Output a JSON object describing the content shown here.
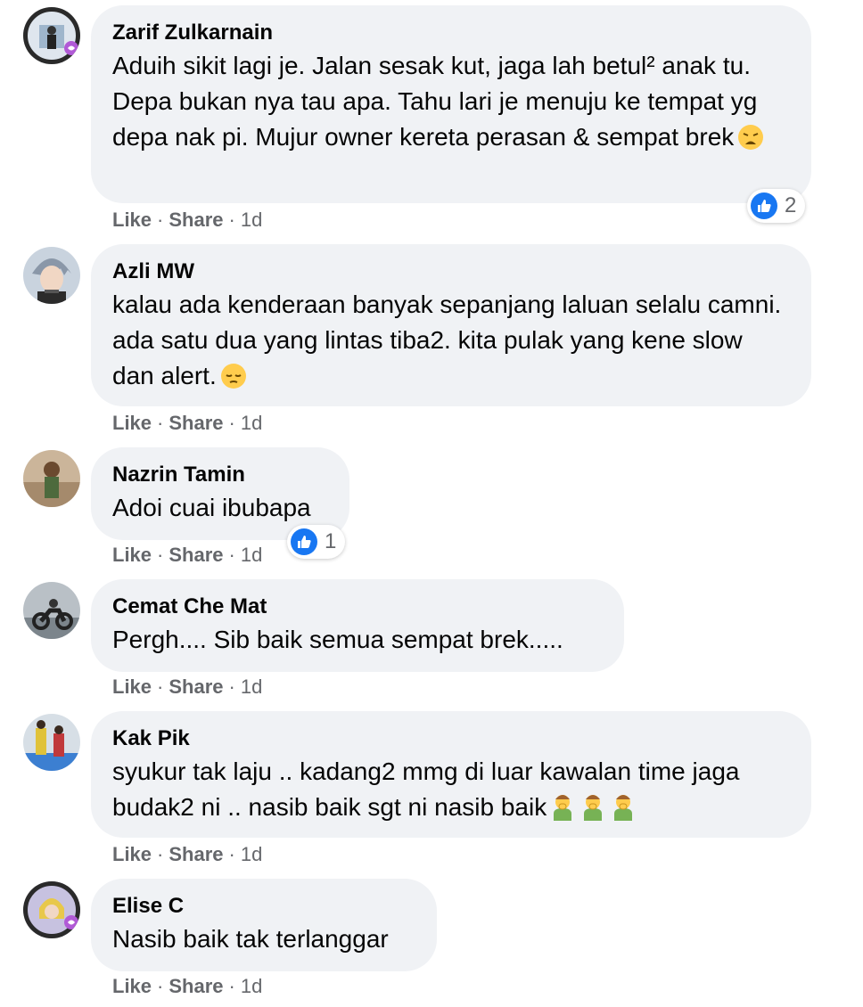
{
  "comments": [
    {
      "author": "Zarif Zulkarnain",
      "text": "Aduih sikit lagi je. Jalan sesak kut, jaga lah betul² anak tu. Depa bukan nya tau apa. Tahu lari je menuju ke tempat yg depa nak pi. Mujur owner kereta perasan & sempat brek",
      "emoji": "weary-face",
      "like_label": "Like",
      "share_label": "Share",
      "time": "1d",
      "reaction_count": "2"
    },
    {
      "author": "Azli MW",
      "text": "kalau ada kenderaan banyak sepanjang laluan selalu camni. ada satu dua yang lintas tiba2. kita pulak yang kene slow dan alert.",
      "emoji": "pensive-face",
      "like_label": "Like",
      "share_label": "Share",
      "time": "1d"
    },
    {
      "author": "Nazrin Tamin",
      "text": "Adoi cuai ibubapa",
      "like_label": "Like",
      "share_label": "Share",
      "time": "1d",
      "reaction_count": "1"
    },
    {
      "author": "Cemat Che Mat",
      "text": "Pergh.... Sib baik semua sempat brek.....",
      "like_label": "Like",
      "share_label": "Share",
      "time": "1d"
    },
    {
      "author": "Kak Pik",
      "text": "syukur tak laju .. kadang2 mmg di luar kawalan time jaga budak2 ni .. nasib baik sgt ni nasib baik",
      "emoji": "nauseated-person x3",
      "like_label": "Like",
      "share_label": "Share",
      "time": "1d"
    },
    {
      "author": "Elise C",
      "text": "Nasib baik tak terlanggar",
      "like_label": "Like",
      "share_label": "Share",
      "time": "1d"
    }
  ],
  "colors": {
    "bubble": "#f0f2f5",
    "meta": "#65676b",
    "like_blue": "#1877f2"
  }
}
